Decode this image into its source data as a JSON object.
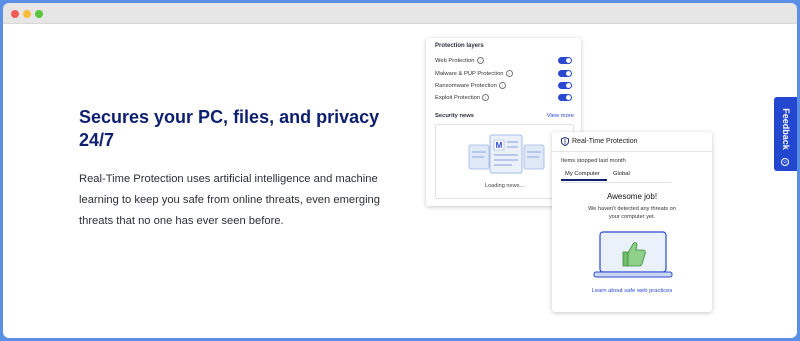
{
  "hero": {
    "headline": "Secures your PC, files, and privacy 24/7",
    "description": "Real-Time Protection uses artificial intelligence and machine learning to keep you safe from online threats, even emerging threats that no one has ever seen before."
  },
  "protection_card": {
    "title": "Protection layers",
    "layers": [
      {
        "label": "Web Protection",
        "enabled": true
      },
      {
        "label": "Malware & PUP Protection",
        "enabled": true
      },
      {
        "label": "Ransomware Protection",
        "enabled": true
      },
      {
        "label": "Exploit Protection",
        "enabled": true
      }
    ],
    "security_news_label": "Security news",
    "view_more": "View more",
    "loading_text": "Loading news..."
  },
  "realtime_card": {
    "title": "Real-Time Protection",
    "items_label": "Items stopped last month",
    "tabs": [
      "My Computer",
      "Global"
    ],
    "awesome_title": "Awesome job!",
    "awesome_sub": "We haven't detected any threats on your computer yet.",
    "learn_link": "Learn about safe web practices"
  },
  "feedback": {
    "label": "Feedback",
    "icon": "smile-icon"
  },
  "colors": {
    "brand_navy": "#0d1f6e",
    "accent_blue": "#2a48d0",
    "frame": "#5b8fe6"
  }
}
